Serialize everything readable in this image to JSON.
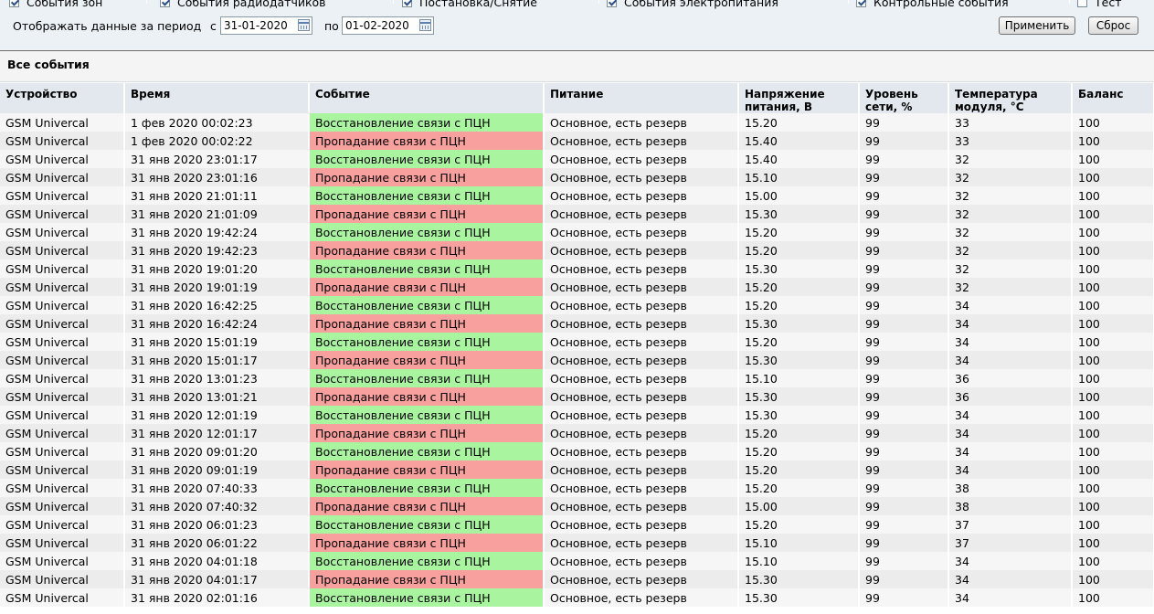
{
  "filters": {
    "checkboxes": [
      {
        "label": "События зон",
        "checked": true
      },
      {
        "label": "События радиодатчиков",
        "checked": true
      },
      {
        "label": "Постановка/Снятие",
        "checked": true
      },
      {
        "label": "События электропитания",
        "checked": true
      },
      {
        "label": "Контрольные события",
        "checked": true
      },
      {
        "label": "Тест",
        "checked": false
      }
    ],
    "period_label": "Отображать данные за период",
    "from_label": "с",
    "from_value": "31-01-2020",
    "to_label": "по",
    "to_value": "01-02-2020",
    "apply_label": "Применить",
    "reset_label": "Сброс"
  },
  "section_title": "Все события",
  "table": {
    "headers": [
      "Устройство",
      "Время",
      "Событие",
      "Питание",
      "Напряжение питания, В",
      "Уровень сети, %",
      "Температура модуля, °С",
      "Баланс"
    ],
    "rows": [
      {
        "device": "GSM Univercal",
        "time": "1 фев 2020 00:02:23",
        "event": "Восстановление связи с ПЦН",
        "status": "restore",
        "power": "Основное, есть резерв",
        "voltage": "15.20",
        "signal": "99",
        "temp": "33",
        "balance": "100"
      },
      {
        "device": "GSM Univercal",
        "time": "1 фев 2020 00:02:22",
        "event": "Пропадание связи с ПЦН",
        "status": "loss",
        "power": "Основное, есть резерв",
        "voltage": "15.40",
        "signal": "99",
        "temp": "33",
        "balance": "100"
      },
      {
        "device": "GSM Univercal",
        "time": "31 янв 2020 23:01:17",
        "event": "Восстановление связи с ПЦН",
        "status": "restore",
        "power": "Основное, есть резерв",
        "voltage": "15.40",
        "signal": "99",
        "temp": "32",
        "balance": "100"
      },
      {
        "device": "GSM Univercal",
        "time": "31 янв 2020 23:01:16",
        "event": "Пропадание связи с ПЦН",
        "status": "loss",
        "power": "Основное, есть резерв",
        "voltage": "15.10",
        "signal": "99",
        "temp": "32",
        "balance": "100"
      },
      {
        "device": "GSM Univercal",
        "time": "31 янв 2020 21:01:11",
        "event": "Восстановление связи с ПЦН",
        "status": "restore",
        "power": "Основное, есть резерв",
        "voltage": "15.00",
        "signal": "99",
        "temp": "32",
        "balance": "100"
      },
      {
        "device": "GSM Univercal",
        "time": "31 янв 2020 21:01:09",
        "event": "Пропадание связи с ПЦН",
        "status": "loss",
        "power": "Основное, есть резерв",
        "voltage": "15.30",
        "signal": "99",
        "temp": "32",
        "balance": "100"
      },
      {
        "device": "GSM Univercal",
        "time": "31 янв 2020 19:42:24",
        "event": "Восстановление связи с ПЦН",
        "status": "restore",
        "power": "Основное, есть резерв",
        "voltage": "15.20",
        "signal": "99",
        "temp": "32",
        "balance": "100"
      },
      {
        "device": "GSM Univercal",
        "time": "31 янв 2020 19:42:23",
        "event": "Пропадание связи с ПЦН",
        "status": "loss",
        "power": "Основное, есть резерв",
        "voltage": "15.20",
        "signal": "99",
        "temp": "32",
        "balance": "100"
      },
      {
        "device": "GSM Univercal",
        "time": "31 янв 2020 19:01:20",
        "event": "Восстановление связи с ПЦН",
        "status": "restore",
        "power": "Основное, есть резерв",
        "voltage": "15.30",
        "signal": "99",
        "temp": "32",
        "balance": "100"
      },
      {
        "device": "GSM Univercal",
        "time": "31 янв 2020 19:01:19",
        "event": "Пропадание связи с ПЦН",
        "status": "loss",
        "power": "Основное, есть резерв",
        "voltage": "15.20",
        "signal": "99",
        "temp": "32",
        "balance": "100"
      },
      {
        "device": "GSM Univercal",
        "time": "31 янв 2020 16:42:25",
        "event": "Восстановление связи с ПЦН",
        "status": "restore",
        "power": "Основное, есть резерв",
        "voltage": "15.20",
        "signal": "99",
        "temp": "34",
        "balance": "100"
      },
      {
        "device": "GSM Univercal",
        "time": "31 янв 2020 16:42:24",
        "event": "Пропадание связи с ПЦН",
        "status": "loss",
        "power": "Основное, есть резерв",
        "voltage": "15.30",
        "signal": "99",
        "temp": "34",
        "balance": "100"
      },
      {
        "device": "GSM Univercal",
        "time": "31 янв 2020 15:01:19",
        "event": "Восстановление связи с ПЦН",
        "status": "restore",
        "power": "Основное, есть резерв",
        "voltage": "15.20",
        "signal": "99",
        "temp": "34",
        "balance": "100"
      },
      {
        "device": "GSM Univercal",
        "time": "31 янв 2020 15:01:17",
        "event": "Пропадание связи с ПЦН",
        "status": "loss",
        "power": "Основное, есть резерв",
        "voltage": "15.30",
        "signal": "99",
        "temp": "34",
        "balance": "100"
      },
      {
        "device": "GSM Univercal",
        "time": "31 янв 2020 13:01:23",
        "event": "Восстановление связи с ПЦН",
        "status": "restore",
        "power": "Основное, есть резерв",
        "voltage": "15.10",
        "signal": "99",
        "temp": "36",
        "balance": "100"
      },
      {
        "device": "GSM Univercal",
        "time": "31 янв 2020 13:01:21",
        "event": "Пропадание связи с ПЦН",
        "status": "loss",
        "power": "Основное, есть резерв",
        "voltage": "15.30",
        "signal": "99",
        "temp": "36",
        "balance": "100"
      },
      {
        "device": "GSM Univercal",
        "time": "31 янв 2020 12:01:19",
        "event": "Восстановление связи с ПЦН",
        "status": "restore",
        "power": "Основное, есть резерв",
        "voltage": "15.30",
        "signal": "99",
        "temp": "34",
        "balance": "100"
      },
      {
        "device": "GSM Univercal",
        "time": "31 янв 2020 12:01:17",
        "event": "Пропадание связи с ПЦН",
        "status": "loss",
        "power": "Основное, есть резерв",
        "voltage": "15.20",
        "signal": "99",
        "temp": "34",
        "balance": "100"
      },
      {
        "device": "GSM Univercal",
        "time": "31 янв 2020 09:01:20",
        "event": "Восстановление связи с ПЦН",
        "status": "restore",
        "power": "Основное, есть резерв",
        "voltage": "15.20",
        "signal": "99",
        "temp": "34",
        "balance": "100"
      },
      {
        "device": "GSM Univercal",
        "time": "31 янв 2020 09:01:19",
        "event": "Пропадание связи с ПЦН",
        "status": "loss",
        "power": "Основное, есть резерв",
        "voltage": "15.20",
        "signal": "99",
        "temp": "34",
        "balance": "100"
      },
      {
        "device": "GSM Univercal",
        "time": "31 янв 2020 07:40:33",
        "event": "Восстановление связи с ПЦН",
        "status": "restore",
        "power": "Основное, есть резерв",
        "voltage": "15.20",
        "signal": "99",
        "temp": "38",
        "balance": "100"
      },
      {
        "device": "GSM Univercal",
        "time": "31 янв 2020 07:40:32",
        "event": "Пропадание связи с ПЦН",
        "status": "loss",
        "power": "Основное, есть резерв",
        "voltage": "15.00",
        "signal": "99",
        "temp": "38",
        "balance": "100"
      },
      {
        "device": "GSM Univercal",
        "time": "31 янв 2020 06:01:23",
        "event": "Восстановление связи с ПЦН",
        "status": "restore",
        "power": "Основное, есть резерв",
        "voltage": "15.20",
        "signal": "99",
        "temp": "37",
        "balance": "100"
      },
      {
        "device": "GSM Univercal",
        "time": "31 янв 2020 06:01:22",
        "event": "Пропадание связи с ПЦН",
        "status": "loss",
        "power": "Основное, есть резерв",
        "voltage": "15.10",
        "signal": "99",
        "temp": "37",
        "balance": "100"
      },
      {
        "device": "GSM Univercal",
        "time": "31 янв 2020 04:01:18",
        "event": "Восстановление связи с ПЦН",
        "status": "restore",
        "power": "Основное, есть резерв",
        "voltage": "15.10",
        "signal": "99",
        "temp": "34",
        "balance": "100"
      },
      {
        "device": "GSM Univercal",
        "time": "31 янв 2020 04:01:17",
        "event": "Пропадание связи с ПЦН",
        "status": "loss",
        "power": "Основное, есть резерв",
        "voltage": "15.30",
        "signal": "99",
        "temp": "34",
        "balance": "100"
      },
      {
        "device": "GSM Univercal",
        "time": "31 янв 2020 02:01:16",
        "event": "Восстановление связи с ПЦН",
        "status": "restore",
        "power": "Основное, есть резерв",
        "voltage": "15.30",
        "signal": "99",
        "temp": "34",
        "balance": "100"
      }
    ]
  },
  "colors": {
    "restore": "#a9f59f",
    "loss": "#f8a09e",
    "header": "#e2e8ed"
  }
}
